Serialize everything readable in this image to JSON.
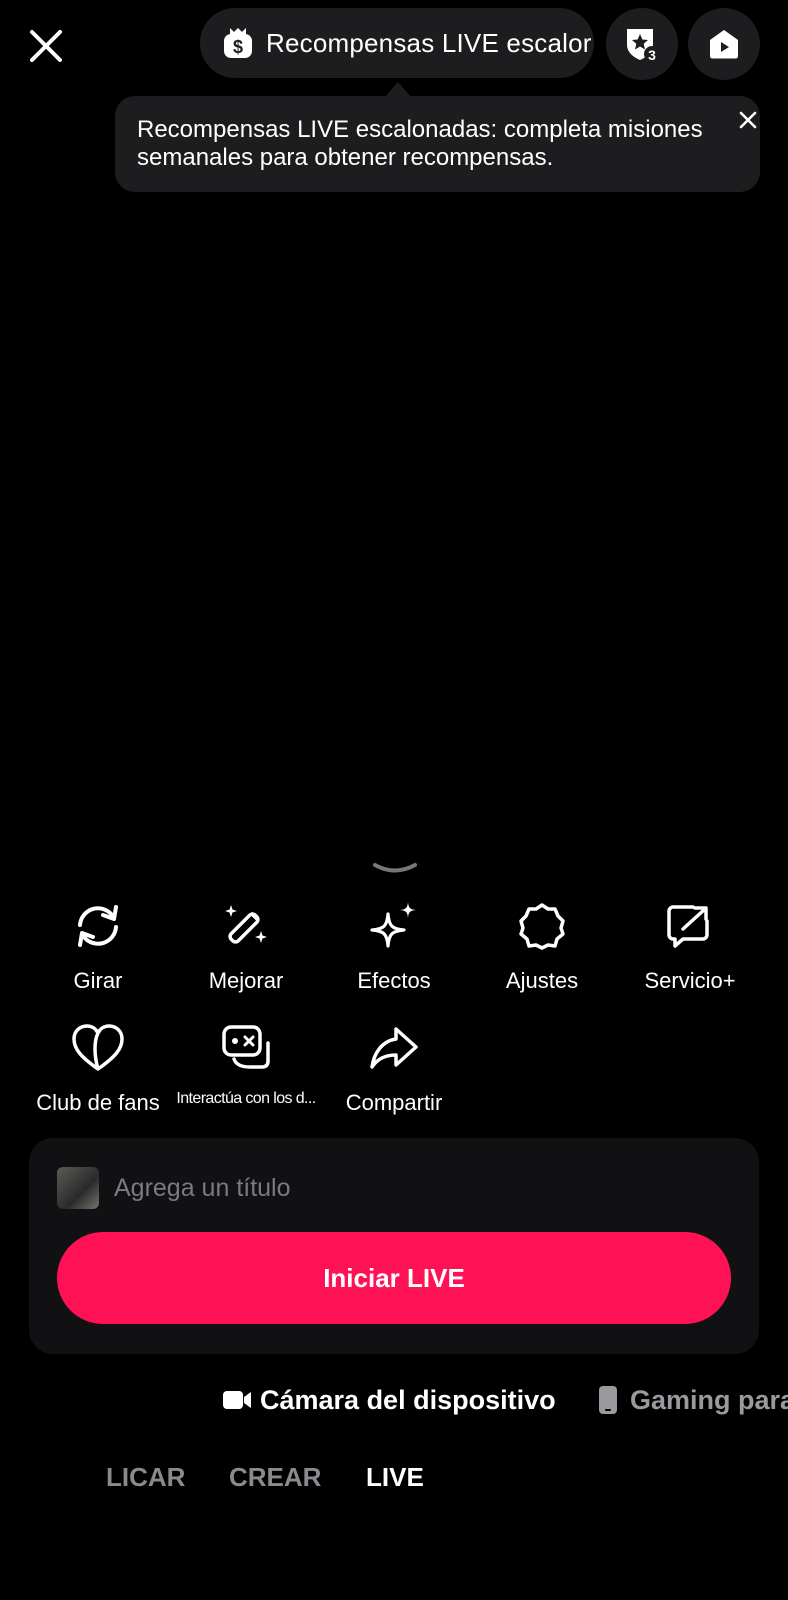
{
  "header": {
    "rewards_pill_label": "Recompensas LIVE escalor",
    "badge_count": "3"
  },
  "tooltip": {
    "text": "Recompensas LIVE escalonadas: completa misiones semanales para obtener recompensas."
  },
  "tools": [
    {
      "label": "Girar",
      "icon": "rotate-icon"
    },
    {
      "label": "Mejorar",
      "icon": "magic-wand-icon"
    },
    {
      "label": "Efectos",
      "icon": "sparkle-icon"
    },
    {
      "label": "Ajustes",
      "icon": "gear-icon"
    },
    {
      "label": "Servicio+",
      "icon": "share-box-icon"
    },
    {
      "label": "Club de fans",
      "icon": "heart-icon"
    },
    {
      "label": "Interactúa con los d...",
      "icon": "game-controller-icon"
    },
    {
      "label": "Compartir",
      "icon": "share-arrow-icon"
    }
  ],
  "setup": {
    "title_placeholder": "Agrega un título",
    "go_live_label": "Iniciar LIVE"
  },
  "sources": {
    "camera_label": "Cámara del dispositivo",
    "gaming_label": "Gaming para"
  },
  "modes": [
    "LICAR",
    "CREAR",
    "LIVE"
  ],
  "colors": {
    "accent": "#fe1155",
    "background": "#000000",
    "surface": "#1d1d1f"
  }
}
